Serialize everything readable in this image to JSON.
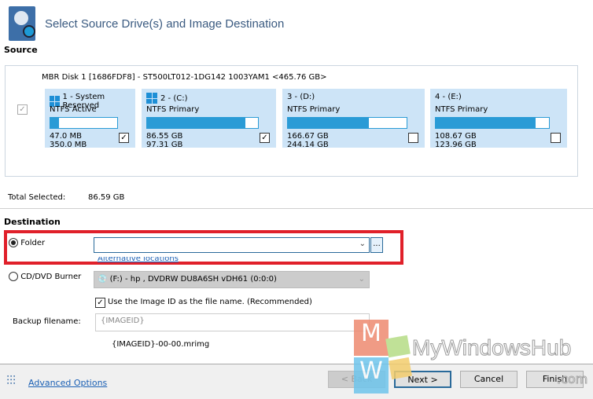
{
  "header": {
    "title": "Select Source Drive(s) and Image Destination",
    "icon": "disk-image-icon"
  },
  "source": {
    "label": "Source",
    "disk_label": "MBR Disk 1 [1686FDF8] - ST500LT012-1DG142 1003YAM1  <465.76 GB>",
    "disk_checked": true,
    "partitions": [
      {
        "name": "1 - System Reserved",
        "fs": "NTFS Active",
        "used": "47.0 MB",
        "total": "350.0 MB",
        "fill_pct": 13,
        "checked": true
      },
      {
        "name": "2 -  (C:)",
        "fs": "NTFS Primary",
        "used": "86.55 GB",
        "total": "97.31 GB",
        "fill_pct": 89,
        "checked": true
      },
      {
        "name": "3 -  (D:)",
        "fs": "NTFS Primary",
        "used": "166.67 GB",
        "total": "244.14 GB",
        "fill_pct": 68,
        "checked": false
      },
      {
        "name": "4 -  (E:)",
        "fs": "NTFS Primary",
        "used": "108.67 GB",
        "total": "123.96 GB",
        "fill_pct": 88,
        "checked": false
      }
    ],
    "total_selected_label": "Total Selected:",
    "total_selected_value": "86.59 GB"
  },
  "destination": {
    "label": "Destination",
    "folder_label": "Folder",
    "folder_value": "",
    "browse_label": "...",
    "alt_link": "Alternative locations",
    "cd_label": "CD/DVD Burner",
    "cd_value": "(F:) - hp       , DVDRW  DU8A6SH   vDH61 (0:0:0)",
    "use_id_label": "Use the Image ID as the file name.  (Recommended)",
    "use_id_checked": true,
    "backup_label": "Backup filename:",
    "backup_value": "{IMAGEID}",
    "preview": "{IMAGEID}-00-00.mrimg"
  },
  "footer": {
    "advanced": "Advanced Options",
    "back": "< Back",
    "next": "Next >",
    "cancel": "Cancel",
    "finish": "Finish"
  },
  "watermark": {
    "text": "MyWindowsHub",
    "suffix": ".com"
  },
  "colors": {
    "accent": "#2a9bd6",
    "highlight": "#e0202a",
    "partition_bg": "#cde4f7"
  }
}
